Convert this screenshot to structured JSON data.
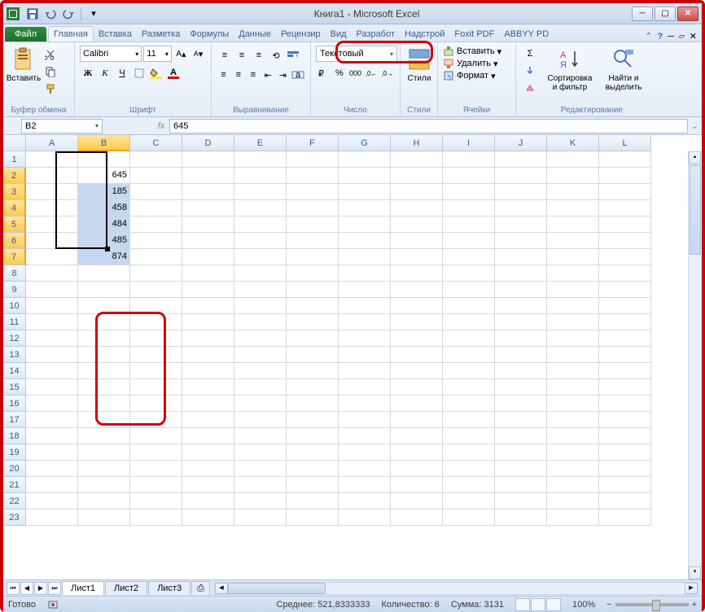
{
  "title": "Книга1 - Microsoft Excel",
  "qat": {
    "save": "save",
    "undo": "undo",
    "redo": "redo"
  },
  "tabs": {
    "file": "Файл",
    "list": [
      "Главная",
      "Вставка",
      "Разметка",
      "Формулы",
      "Данные",
      "Рецензир",
      "Вид",
      "Разработ",
      "Надстрой",
      "Foxit PDF",
      "ABBYY PD"
    ],
    "active": 0
  },
  "ribbon": {
    "clipboard": {
      "paste": "Вставить",
      "label": "Буфер обмена"
    },
    "font": {
      "family": "Calibri",
      "size": "11",
      "label": "Шрифт"
    },
    "alignment": {
      "label": "Выравнивание"
    },
    "number": {
      "format": "Текстовый",
      "label": "Число"
    },
    "styles": {
      "label": "Стили",
      "btn": "Стили"
    },
    "cells": {
      "insert": "Вставить",
      "delete": "Удалить",
      "format": "Формат",
      "label": "Ячейки"
    },
    "editing": {
      "sort": "Сортировка\nи фильтр",
      "find": "Найти и\nвыделить",
      "label": "Редактирование"
    }
  },
  "formula_bar": {
    "name_box": "B2",
    "fx": "fx",
    "value": "645"
  },
  "grid": {
    "columns": [
      "A",
      "B",
      "C",
      "D",
      "E",
      "F",
      "G",
      "H",
      "I",
      "J",
      "K",
      "L"
    ],
    "rows": 23,
    "selected_col": 1,
    "selected_rows": [
      2,
      3,
      4,
      5,
      6,
      7
    ],
    "data": {
      "B2": "645",
      "B3": "185",
      "B4": "458",
      "B5": "484",
      "B6": "485",
      "B7": "874"
    }
  },
  "sheets": {
    "list": [
      "Лист1",
      "Лист2",
      "Лист3"
    ],
    "active": 0
  },
  "status": {
    "ready": "Готово",
    "avg_label": "Среднее:",
    "avg": "521,8333333",
    "count_label": "Количество:",
    "count": "6",
    "sum_label": "Сумма:",
    "sum": "3131",
    "zoom": "100%"
  }
}
